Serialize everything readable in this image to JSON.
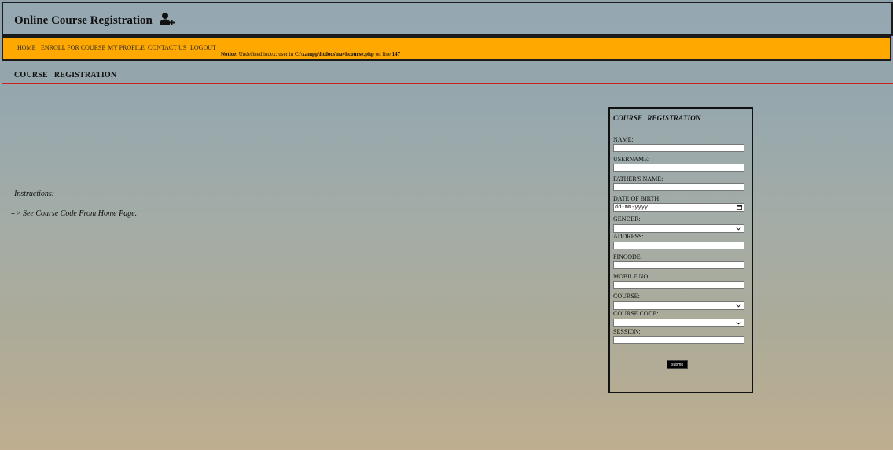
{
  "header": {
    "title": "Online Course Registration"
  },
  "nav": {
    "items": [
      {
        "label": "HOME"
      },
      {
        "label": "ENROLL FOR COURSE"
      },
      {
        "label": "MY PROFILE"
      },
      {
        "label": "CONTACT US"
      },
      {
        "label": "LOGOUT"
      }
    ],
    "notice": {
      "label": "Notice",
      "text_1": ": Undefined index: user in ",
      "path": "C:\\xampp\\htdocs\\navi\\course.php",
      "text_2": " on line ",
      "line": "147"
    }
  },
  "page": {
    "heading_word_1": "COURSE",
    "heading_word_2": "REGISTRATION"
  },
  "instructions": {
    "title": "Instructions:-",
    "line": "=> See Course Code From Home Page."
  },
  "form": {
    "title_word_1": "COURSE",
    "title_word_2": "REGISTRATION",
    "fields": {
      "name": {
        "label": "NAME:",
        "value": ""
      },
      "username": {
        "label": "USERNAME:",
        "value": ""
      },
      "father_name": {
        "label": "FATHER'S NAME:",
        "value": ""
      },
      "dob": {
        "label": "DATE OF BIRTH:",
        "placeholder": "dd-mm-yyyy"
      },
      "gender": {
        "label": "GENDER:",
        "selected": ""
      },
      "address": {
        "label": "ADDRESS:",
        "value": ""
      },
      "pincode": {
        "label": "PINCODE:",
        "value": ""
      },
      "mobile": {
        "label": "MOBILE NO:",
        "value": ""
      },
      "course": {
        "label": "COURSE:",
        "selected": ""
      },
      "course_code": {
        "label": "COURSE CODE:",
        "selected": ""
      },
      "session": {
        "label": "SESSION:",
        "value": ""
      }
    },
    "submit_label": "submit"
  },
  "colors": {
    "nav_background": "#ffa800",
    "rule_red": "#cc2222",
    "border": "#1b1b1b"
  },
  "icons": {
    "header_icon": "user-add-icon",
    "select_icon": "chevron-down-icon",
    "date_icon": "calendar-icon"
  }
}
